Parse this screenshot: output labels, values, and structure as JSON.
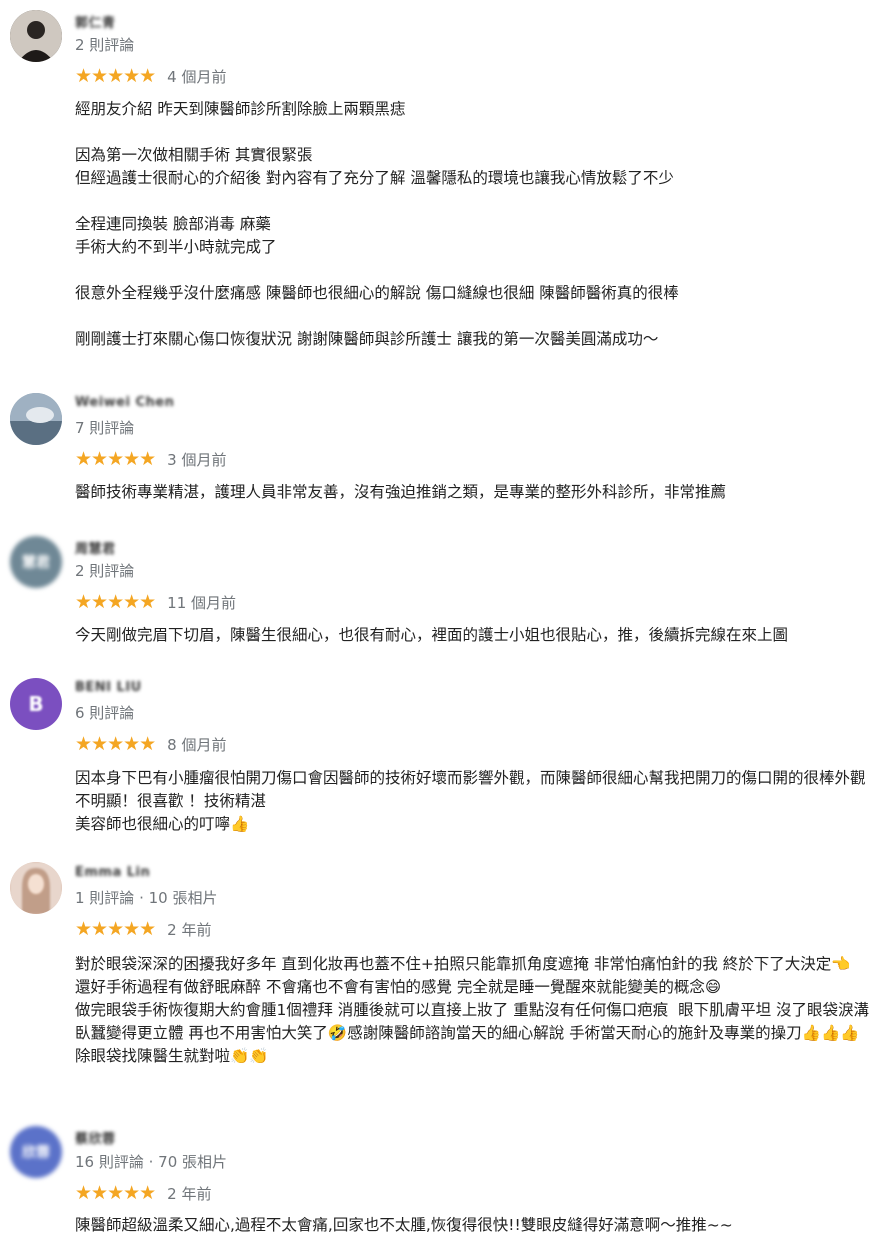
{
  "reviews": [
    {
      "name": "郭仁青",
      "meta": "2 則評論",
      "stars": "★★★★★",
      "time": "4 個月前",
      "text": "經朋友介紹 昨天到陳醫師診所割除臉上兩顆黑痣\n\n因為第一次做相關手術 其實很緊張\n但經過護士很耐心的介紹後 對內容有了充分了解 溫馨隱私的環境也讓我心情放鬆了不少\n\n全程連同換裝 臉部消毒 麻藥\n手術大約不到半小時就完成了\n\n很意外全程幾乎沒什麼痛感 陳醫師也很細心的解說 傷口縫線也很細 陳醫師醫術真的很棒\n\n剛剛護士打來關心傷口恢復狀況 謝謝陳醫師與診所護士 讓我的第一次醫美圓滿成功～",
      "avatar_text": "",
      "avatar_color": "#3a3530"
    },
    {
      "name": "Weiwei Chen",
      "meta": "7 則評論",
      "stars": "★★★★★",
      "time": "3 個月前",
      "text": "醫師技術專業精湛，護理人員非常友善，沒有強迫推銷之類，是專業的整形外科診所，非常推薦",
      "avatar_text": "",
      "avatar_color": "#7d93a6"
    },
    {
      "name": "周慧君",
      "meta": "2 則評論",
      "stars": "★★★★★",
      "time": "11 個月前",
      "text": "今天剛做完眉下切眉，陳醫生很細心，也很有耐心，裡面的護士小姐也很貼心，推，後續拆完線在來上圖",
      "avatar_text": "慧君",
      "avatar_color": "#6f8896"
    },
    {
      "name": "BENI LIU",
      "meta": "6 則評論",
      "stars": "★★★★★",
      "time": "8 個月前",
      "text": "因本身下巴有小腫瘤很怕開刀傷口會因醫師的技術好壞而影響外觀，而陳醫師很細心幫我把開刀的傷口開的很棒外觀不明顯！很喜歡 ！技術精湛\n美容師也很細心的叮嚀👍",
      "avatar_text": "B",
      "avatar_color": "#7b4fc0"
    },
    {
      "name": "Emma Lin",
      "meta": "1 則評論 · 10 張相片",
      "stars": "★★★★★",
      "time": "2 年前",
      "text": "對於眼袋深深的困擾我好多年 直到化妝再也蓋不住+拍照只能靠抓角度遮掩 非常怕痛怕針的我 終於下了大決定👈\n還好手術過程有做舒眠麻醉 不會痛也不會有害怕的感覺 完全就是睡一覺醒來就能變美的概念😄\n做完眼袋手術恢復期大約會腫1個禮拜 消腫後就可以直接上妝了 重點沒有任何傷口疤痕  眼下肌膚平坦 沒了眼袋淚溝 臥蠶變得更立體 再也不用害怕大笑了🤣感謝陳醫師諮詢當天的細心解說 手術當天耐心的施針及專業的操刀👍👍👍除眼袋找陳醫生就對啦👏👏",
      "avatar_text": "",
      "avatar_color": "#d9b9a6"
    },
    {
      "name": "蔡欣蓉",
      "meta": "16 則評論 · 70 張相片",
      "stars": "★★★★★",
      "time": "2 年前",
      "text": "陳醫師超級溫柔又細心,過程不太會痛,回家也不太腫,恢復得很快!!雙眼皮縫得好滿意啊～推推~~",
      "avatar_text": "欣蓉",
      "avatar_color": "#5b72c9"
    }
  ]
}
